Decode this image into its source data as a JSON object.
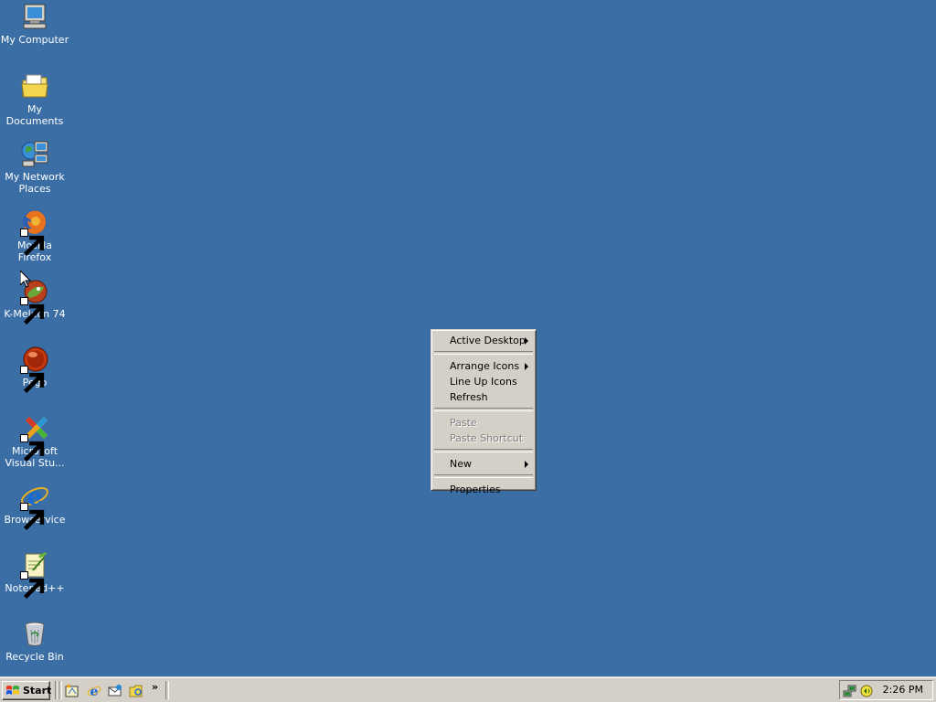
{
  "desktop": {
    "background_color": "#3a6ea5",
    "icons": [
      {
        "label": "My Computer",
        "icon": "computer-icon"
      },
      {
        "label": "My Documents",
        "icon": "folder-icon"
      },
      {
        "label": "My Network Places",
        "icon": "network-icon"
      },
      {
        "label": "Mozilla Firefox",
        "icon": "firefox-icon"
      },
      {
        "label": "K-Meleon 74",
        "icon": "kmeleon-icon"
      },
      {
        "label": "Pego",
        "icon": "pego-icon"
      },
      {
        "label": "Microsoft Visual Stu...",
        "icon": "visual-studio-icon"
      },
      {
        "label": "Browservice",
        "icon": "ie-icon"
      },
      {
        "label": "Notepad++",
        "icon": "notepad-icon"
      },
      {
        "label": "Recycle Bin",
        "icon": "recycle-bin-icon"
      }
    ]
  },
  "context_menu": {
    "items": [
      {
        "label": "Active Desktop",
        "submenu": true,
        "enabled": true
      },
      {
        "label": "Arrange Icons",
        "submenu": true,
        "enabled": true
      },
      {
        "label": "Line Up Icons",
        "submenu": false,
        "enabled": true
      },
      {
        "label": "Refresh",
        "submenu": false,
        "enabled": true
      },
      {
        "label": "Paste",
        "submenu": false,
        "enabled": false
      },
      {
        "label": "Paste Shortcut",
        "submenu": false,
        "enabled": false
      },
      {
        "label": "New",
        "submenu": true,
        "enabled": true
      },
      {
        "label": "Properties",
        "submenu": false,
        "enabled": true
      }
    ]
  },
  "taskbar": {
    "start_label": "Start",
    "quick_launch": [
      {
        "icon": "show-desktop-icon"
      },
      {
        "icon": "ie-icon"
      },
      {
        "icon": "outlook-express-icon"
      },
      {
        "icon": "explorer-icon"
      }
    ],
    "more_label": "»",
    "tray_icons": [
      "network-tray-icon",
      "volume-tray-icon"
    ],
    "clock": "2:26 PM"
  }
}
